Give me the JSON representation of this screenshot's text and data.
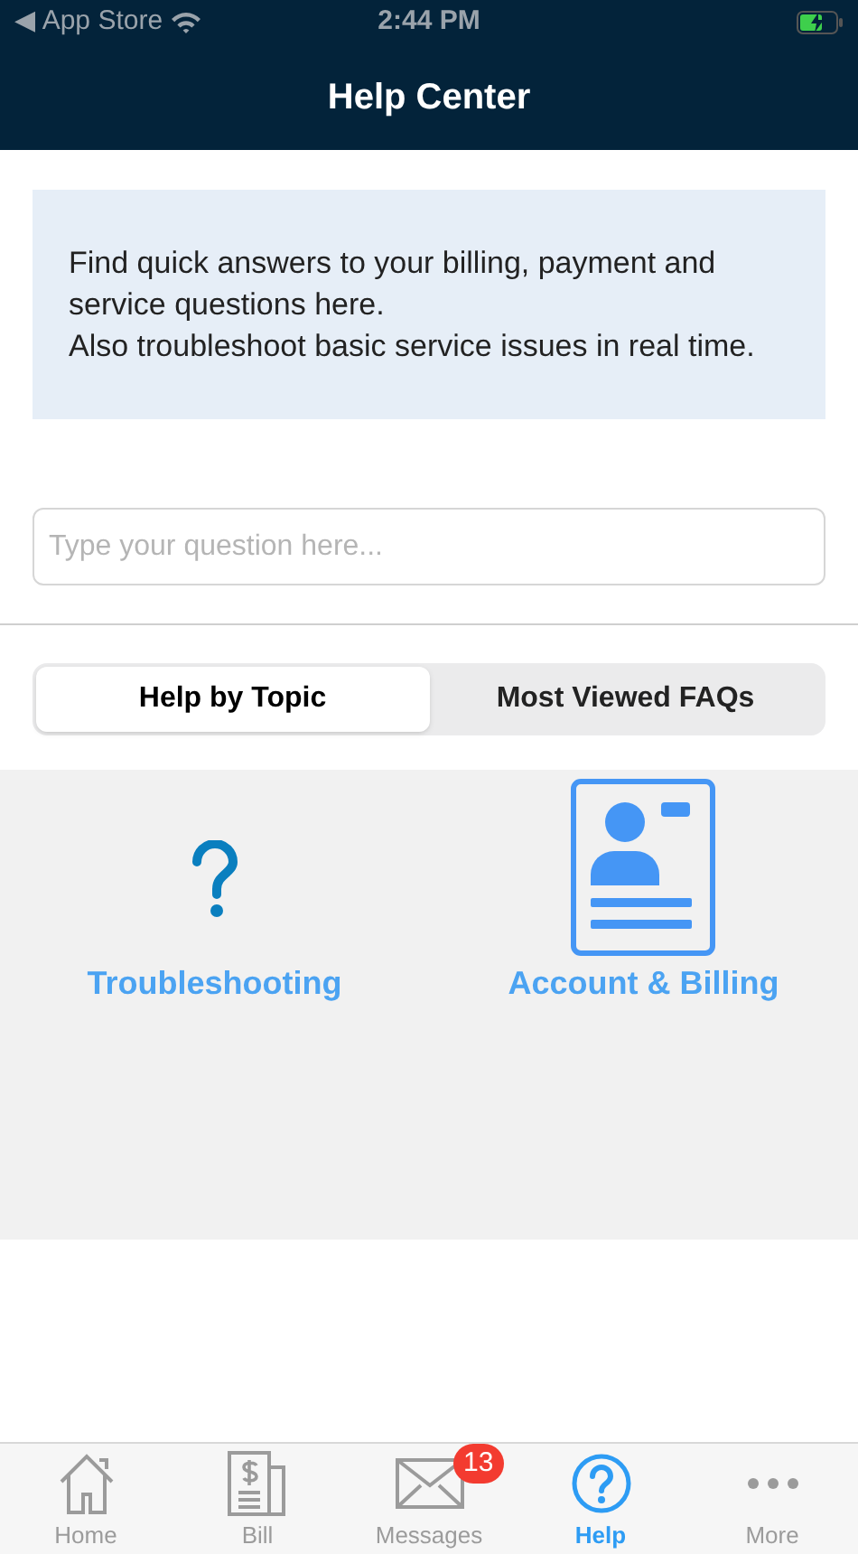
{
  "status_bar": {
    "back_label": "◀ App Store",
    "time": "2:44 PM"
  },
  "nav_bar": {
    "title": "Help Center"
  },
  "intro": {
    "lines": [
      "Find quick answers to your billing, payment and service questions here.",
      "Also troubleshoot basic service issues in real time."
    ]
  },
  "search": {
    "placeholder": "Type your question here..."
  },
  "segments": [
    {
      "label": "Help by Topic",
      "selected": true
    },
    {
      "label": "Most Viewed FAQs",
      "selected": false
    }
  ],
  "topics": [
    {
      "kind": "question",
      "label": "Troubleshooting"
    },
    {
      "kind": "card",
      "label": "Account & Billing"
    }
  ],
  "tab_bar": [
    {
      "kind": "home",
      "label": "Home",
      "selected": false
    },
    {
      "kind": "bill",
      "label": "Bill",
      "selected": false
    },
    {
      "kind": "mail",
      "label": "Messages",
      "selected": false,
      "badge": "13"
    },
    {
      "kind": "help",
      "label": "Help",
      "selected": true
    },
    {
      "kind": "more",
      "label": "More",
      "selected": false
    }
  ]
}
